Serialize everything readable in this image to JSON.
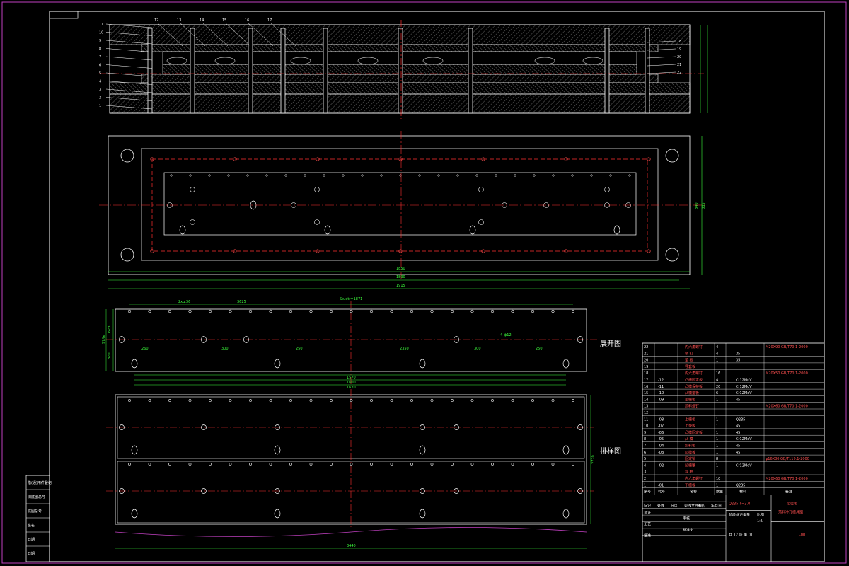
{
  "drawing": {
    "section_view": {
      "part_numbers_left": [
        "11",
        "10",
        "9",
        "8",
        "7",
        "6",
        "5",
        "4",
        "3",
        "2",
        "1"
      ],
      "part_numbers_top": [
        "12",
        "13",
        "14",
        "15",
        "16",
        "17"
      ],
      "part_numbers_right": [
        "18",
        "19",
        "20",
        "21",
        "22"
      ]
    },
    "plan_view": {
      "dims": [
        "1850",
        "1890",
        "1915",
        "340",
        "385"
      ]
    },
    "development": {
      "label": "展开图",
      "dims_top": [
        "2xu.36",
        "3625",
        "Stuetr=1871"
      ],
      "dims_mid": [
        "260",
        "300",
        "250",
        "2350",
        "300",
        "250",
        "4-ф12"
      ],
      "dims_bottom": [
        "1570",
        "1600",
        "1670"
      ],
      "dims_left": [
        "673",
        "97/fe",
        "370"
      ]
    },
    "layout": {
      "label": "排样图",
      "dim_bottom": "3440",
      "dim_right": "2770"
    },
    "bom": {
      "rows": [
        {
          "no": "22",
          "code": "",
          "name": "内六角螺钉",
          "qty": "4",
          "mat": "",
          "note": "M20X90 GB/T70.1-2000"
        },
        {
          "no": "21",
          "code": "",
          "name": "销  钉",
          "qty": "4",
          "mat": "35",
          "note": ""
        },
        {
          "no": "20",
          "code": "",
          "name": "垫  板",
          "qty": "1",
          "mat": "35",
          "note": ""
        },
        {
          "no": "19",
          "code": "",
          "name": "导套板",
          "qty": "",
          "mat": "",
          "note": ""
        },
        {
          "no": "18",
          "code": "",
          "name": "内六角螺钉",
          "qty": "16",
          "mat": "",
          "note": "M20X50 GB/T70.1-2000"
        },
        {
          "no": "17",
          "code": "-12",
          "name": "凸模固定板",
          "qty": "4",
          "mat": "Cr12MoV",
          "note": ""
        },
        {
          "no": "16",
          "code": "-11",
          "name": "凸模保护板",
          "qty": "20",
          "mat": "Cr12MoV",
          "note": ""
        },
        {
          "no": "15",
          "code": "-10",
          "name": "凸模垫板",
          "qty": "6",
          "mat": "Cr12MoV",
          "note": ""
        },
        {
          "no": "14",
          "code": "-09",
          "name": "垫模板",
          "qty": "1",
          "mat": "45",
          "note": ""
        },
        {
          "no": "13",
          "code": "",
          "name": "卸料螺钉",
          "qty": "",
          "mat": "",
          "note": "M20X60 GB/T70.1-2000"
        },
        {
          "no": "12",
          "code": "",
          "name": "",
          "qty": "",
          "mat": "",
          "note": ""
        },
        {
          "no": "11",
          "code": "-08",
          "name": "上模板",
          "qty": "1",
          "mat": "Q235",
          "note": ""
        },
        {
          "no": "10",
          "code": "-07",
          "name": "上垫板",
          "qty": "1",
          "mat": "45",
          "note": ""
        },
        {
          "no": "9",
          "code": "-06",
          "name": "凸模固定板",
          "qty": "1",
          "mat": "45",
          "note": ""
        },
        {
          "no": "8",
          "code": "-05",
          "name": "凸  模",
          "qty": "1",
          "mat": "Cr12MoV",
          "note": ""
        },
        {
          "no": "7",
          "code": "-04",
          "name": "卸料板",
          "qty": "1",
          "mat": "45",
          "note": ""
        },
        {
          "no": "6",
          "code": "-03",
          "name": "凹模板",
          "qty": "1",
          "mat": "45",
          "note": ""
        },
        {
          "no": "5",
          "code": "",
          "name": "固定销",
          "qty": "8",
          "mat": "",
          "note": "φ16X80 GB/T119.1-2000"
        },
        {
          "no": "4",
          "code": "-02",
          "name": "凹模镶",
          "qty": "1",
          "mat": "Cr12MoV",
          "note": ""
        },
        {
          "no": "3",
          "code": "",
          "name": "导  柱",
          "qty": "",
          "mat": "",
          "note": ""
        },
        {
          "no": "2",
          "code": "",
          "name": "内六角螺钉",
          "qty": "10",
          "mat": "",
          "note": "M20X60 GB/T70.1-2000"
        },
        {
          "no": "1",
          "code": "-01",
          "name": "下模板",
          "qty": "1",
          "mat": "Q235",
          "note": ""
        }
      ],
      "header": {
        "no": "序号",
        "code": "代号",
        "name": "名称",
        "qty": "数量",
        "mat": "材料",
        "note": "备注"
      },
      "material_spec": "Q235  T=3.0",
      "title_line1": "定位板",
      "title_line2": "落料冲孔模具图",
      "drawing_no": "-00",
      "scale": "1:1",
      "sheet": "共 12 张  第 01",
      "row_labels": [
        "标记",
        "处数",
        "分区",
        "更改文件号",
        "签名",
        "年月日"
      ],
      "sign_labels": [
        "设计",
        "审核",
        "工艺",
        "标准化",
        "批准"
      ],
      "stage_labels": [
        "阶段标记",
        "重量",
        "比例"
      ]
    },
    "side_table": [
      "借(通)用件登记",
      "旧底图总号",
      "底图总号",
      "签名",
      "日期",
      "日期"
    ]
  }
}
